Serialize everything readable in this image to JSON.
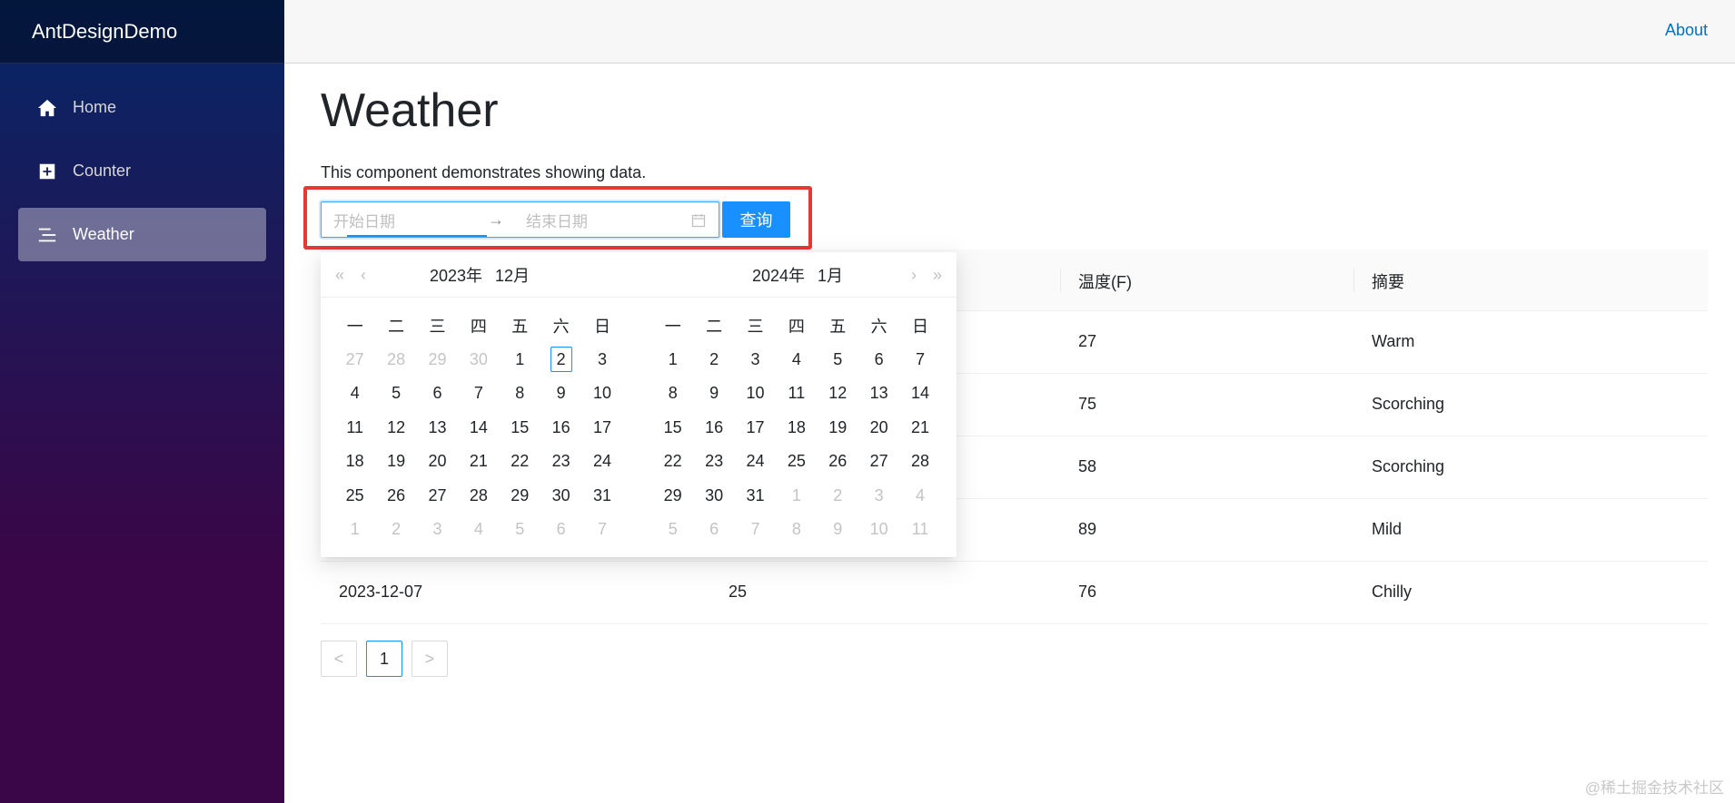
{
  "brand": "AntDesignDemo",
  "nav": [
    {
      "label": "Home",
      "icon": "home-icon"
    },
    {
      "label": "Counter",
      "icon": "plus-square-icon"
    },
    {
      "label": "Weather",
      "icon": "list-icon"
    }
  ],
  "top": {
    "about": "About"
  },
  "page": {
    "title": "Weather",
    "description": "This component demonstrates showing data."
  },
  "range_picker": {
    "start_placeholder": "开始日期",
    "separator": "→",
    "end_placeholder": "结束日期"
  },
  "query_button": "查询",
  "table": {
    "columns": [
      "",
      "",
      "温度(F)",
      "摘要"
    ],
    "rows": [
      [
        "",
        "",
        "27",
        "Warm"
      ],
      [
        "",
        "",
        "75",
        "Scorching"
      ],
      [
        "",
        "",
        "58",
        "Scorching"
      ],
      [
        "",
        "",
        "89",
        "Mild"
      ],
      [
        "2023-12-07",
        "25",
        "76",
        "Chilly"
      ]
    ]
  },
  "pagination": {
    "prev": "<",
    "current": "1",
    "next": ">"
  },
  "calendar": {
    "left": {
      "year": "2023年",
      "month": "12月"
    },
    "right": {
      "year": "2024年",
      "month": "1月"
    },
    "weekdays": [
      "一",
      "二",
      "三",
      "四",
      "五",
      "六",
      "日"
    ],
    "left_days": [
      [
        "27",
        "28",
        "29",
        "30",
        "1",
        "2",
        "3"
      ],
      [
        "4",
        "5",
        "6",
        "7",
        "8",
        "9",
        "10"
      ],
      [
        "11",
        "12",
        "13",
        "14",
        "15",
        "16",
        "17"
      ],
      [
        "18",
        "19",
        "20",
        "21",
        "22",
        "23",
        "24"
      ],
      [
        "25",
        "26",
        "27",
        "28",
        "29",
        "30",
        "31"
      ],
      [
        "1",
        "2",
        "3",
        "4",
        "5",
        "6",
        "7"
      ]
    ],
    "right_days": [
      [
        "1",
        "2",
        "3",
        "4",
        "5",
        "6",
        "7"
      ],
      [
        "8",
        "9",
        "10",
        "11",
        "12",
        "13",
        "14"
      ],
      [
        "15",
        "16",
        "17",
        "18",
        "19",
        "20",
        "21"
      ],
      [
        "22",
        "23",
        "24",
        "25",
        "26",
        "27",
        "28"
      ],
      [
        "29",
        "30",
        "31",
        "1",
        "2",
        "3",
        "4"
      ],
      [
        "5",
        "6",
        "7",
        "8",
        "9",
        "10",
        "11"
      ]
    ],
    "nav": {
      "super_prev": "«",
      "prev": "‹",
      "next": "›",
      "super_next": "»"
    }
  },
  "watermark": "@稀土掘金技术社区"
}
